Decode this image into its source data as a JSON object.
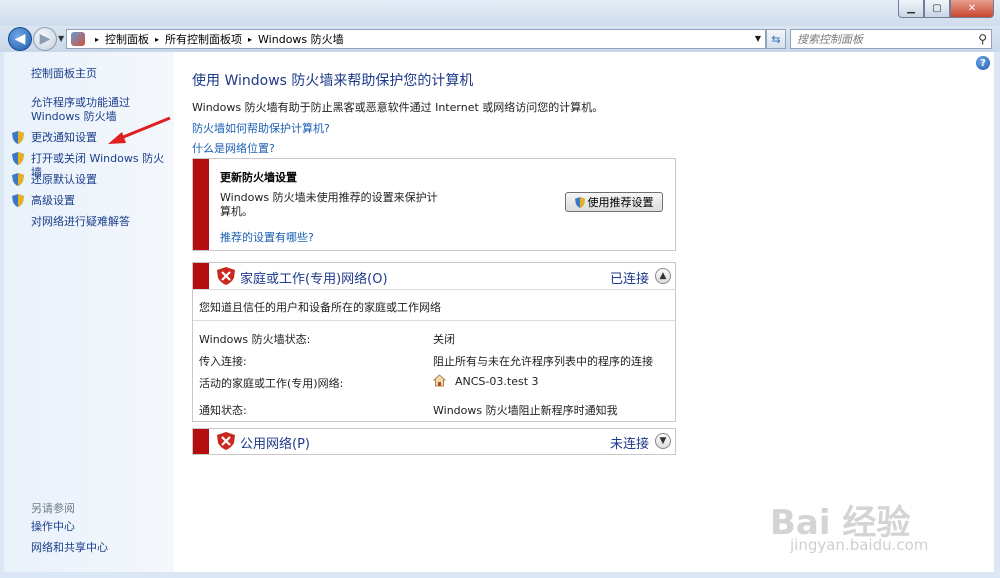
{
  "window": {
    "min": "▁",
    "max": "▢",
    "close": "✕"
  },
  "address": {
    "crumbs": [
      "控制面板",
      "所有控制面板项",
      "Windows 防火墙"
    ],
    "sep": "▸",
    "search_placeholder": "搜索控制面板"
  },
  "sidebar": {
    "home": "控制面板主页",
    "allow": "允许程序或功能通过 Windows 防火墙",
    "items": [
      "更改通知设置",
      "打开或关闭 Windows 防火墙",
      "还原默认设置",
      "高级设置"
    ],
    "troubleshoot": "对网络进行疑难解答",
    "see_also": "另请参阅",
    "also_items": [
      "操作中心",
      "网络和共享中心"
    ]
  },
  "main": {
    "title": "使用 Windows 防火墙来帮助保护您的计算机",
    "intro": "Windows 防火墙有助于防止黑客或恶意软件通过 Internet 或网络访问您的计算机。",
    "link1": "防火墙如何帮助保护计算机?",
    "link2": "什么是网络位置?",
    "update": {
      "title": "更新防火墙设置",
      "desc": "Windows 防火墙未使用推荐的设置来保护计算机。",
      "button": "使用推荐设置",
      "link": "推荐的设置有哪些?"
    },
    "home_net": {
      "name": "家庭或工作(专用)网络(O)",
      "status": "已连接",
      "desc": "您知道且信任的用户和设备所在的家庭或工作网络",
      "rows": [
        {
          "label": "Windows 防火墙状态:",
          "value": "关闭"
        },
        {
          "label": "传入连接:",
          "value": "阻止所有与未在允许程序列表中的程序的连接"
        },
        {
          "label": "活动的家庭或工作(专用)网络:",
          "value": "ANCS-03.test  3"
        },
        {
          "label": "通知状态:",
          "value": "Windows 防火墙阻止新程序时通知我"
        }
      ]
    },
    "public_net": {
      "name": "公用网络(P)",
      "status": "未连接"
    }
  },
  "watermark": {
    "main": "Bai 经验",
    "sub": "jingyan.baidu.com"
  },
  "colors": {
    "accent": "#1e3a8a",
    "link": "#1a5fb4",
    "alert": "#b40e0e"
  }
}
